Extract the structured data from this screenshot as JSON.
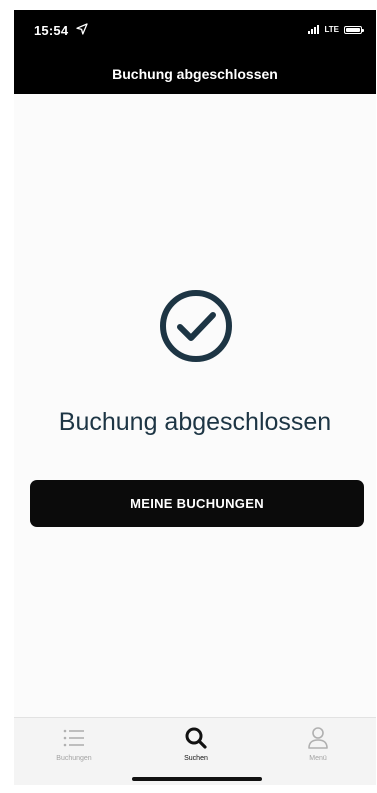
{
  "status_bar": {
    "time": "15:54",
    "network": "LTE",
    "icons": [
      "location-arrow-icon",
      "signal-icon",
      "battery-icon"
    ]
  },
  "header": {
    "title": "Buchung abgeschlossen"
  },
  "main": {
    "icon": "check-circle-icon",
    "title": "Buchung abgeschlossen",
    "button_label": "MEINE BUCHUNGEN"
  },
  "tabbar": {
    "items": [
      {
        "label": "Buchungen",
        "icon": "list-icon",
        "active": false
      },
      {
        "label": "Suchen",
        "icon": "search-icon",
        "active": true
      },
      {
        "label": "Menü",
        "icon": "user-icon",
        "active": false
      }
    ]
  },
  "colors": {
    "header_bg": "#000000",
    "accent": "#1d3544",
    "button_bg": "#0b0b0b",
    "tabbar_bg": "#f4f4f4",
    "tab_inactive": "#a3a3a3"
  }
}
